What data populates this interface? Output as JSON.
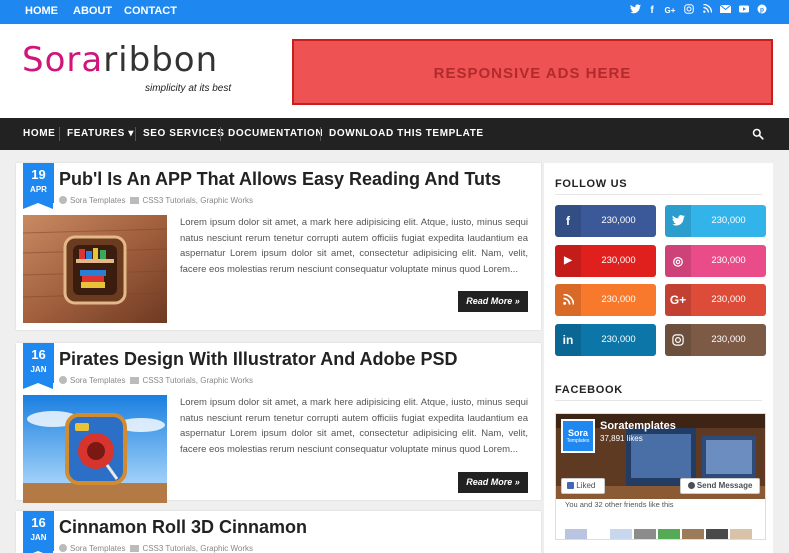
{
  "topbar": {
    "links": [
      "HOME",
      "ABOUT",
      "CONTACT"
    ],
    "social_icons": [
      "twitter-icon",
      "facebook-icon",
      "google-plus-icon",
      "instagram-icon",
      "rss-icon",
      "email-icon",
      "youtube-icon",
      "pinterest-icon"
    ],
    "color": "#1e88f0"
  },
  "header": {
    "logo_part1": "Sora",
    "logo_part2": "ribbon",
    "tagline": "simplicity at its best",
    "ad_text": "RESPONSIVE ADS HERE"
  },
  "nav": {
    "items": [
      "HOME",
      "FEATURES",
      "SEO SERVICES",
      "DOCUMENTATION",
      "DOWNLOAD THIS TEMPLATE"
    ],
    "features_caret": "▾"
  },
  "posts": [
    {
      "day": "19",
      "month": "APR",
      "title": "Pub'l Is An APP That Allows Easy Reading And Tuts",
      "author": "Sora Templates",
      "label1": "CSS3 Tutorials",
      "label2": ", Graphic Works",
      "excerpt": "Lorem ipsum dolor sit amet, a mark here adipisicing elit. Atque, iusto, minus sequi natus nesciunt rerum tenetur corrupti autem officiis fugiat expedita laudantium ea aspernatur Lorem ipsum dolor sit amet, consectetur adipisicing elit. Nam, velit, facere eos molestias rerum nesciunt consequatur voluptate minus quod Lorem...",
      "read_more": "Read More »"
    },
    {
      "day": "16",
      "month": "JAN",
      "title": "Pirates Design With Illustrator And Adobe PSD",
      "author": "Sora Templates",
      "label1": "CSS3 Tutorials",
      "label2": ", Graphic Works",
      "excerpt": "Lorem ipsum dolor sit amet, a mark here adipisicing elit. Atque, iusto, minus sequi natus nesciunt rerum tenetur corrupti autem officiis fugiat expedita laudantium ea aspernatur Lorem ipsum dolor sit amet, consectetur adipisicing elit. Nam, velit, facere eos molestias rerum nesciunt consequatur voluptate minus quod Lorem...",
      "read_more": "Read More »"
    },
    {
      "day": "16",
      "month": "JAN",
      "title": "Cinnamon Roll 3D Cinnamon",
      "author": "Sora Templates",
      "label1": "CSS3 Tutorials",
      "label2": ", Graphic Works"
    }
  ],
  "sidebar": {
    "follow_title": "FOLLOW US",
    "social": [
      {
        "icon": "facebook-icon",
        "glyph": "f",
        "count": "230,000",
        "color": "#3b5998"
      },
      {
        "icon": "twitter-icon",
        "glyph": "t",
        "count": "230,000",
        "color": "#32b4ea"
      },
      {
        "icon": "youtube-icon",
        "glyph": "▶",
        "count": "230,000",
        "color": "#e0201d"
      },
      {
        "icon": "dribbble-icon",
        "glyph": "◎",
        "count": "230,000",
        "color": "#ea4c89"
      },
      {
        "icon": "rss-icon",
        "glyph": ")",
        "count": "230,000",
        "color": "#f8782c"
      },
      {
        "icon": "google-plus-icon",
        "glyph": "G+",
        "count": "230,000",
        "color": "#dd4b39"
      },
      {
        "icon": "linkedin-icon",
        "glyph": "in",
        "count": "230,000",
        "color": "#0c76a8"
      },
      {
        "icon": "instagram-icon",
        "glyph": "◘",
        "count": "230,000",
        "color": "#7c5a46"
      }
    ],
    "facebook_title": "FACEBOOK",
    "fb_page_name": "Soratemplates",
    "fb_likes": "37,891 likes",
    "fb_logo_text": "Sora",
    "fb_logo_sub": "Templates",
    "fb_liked": "Liked",
    "fb_send": "Send Message",
    "fb_friends": "You and 32 other friends like this"
  }
}
